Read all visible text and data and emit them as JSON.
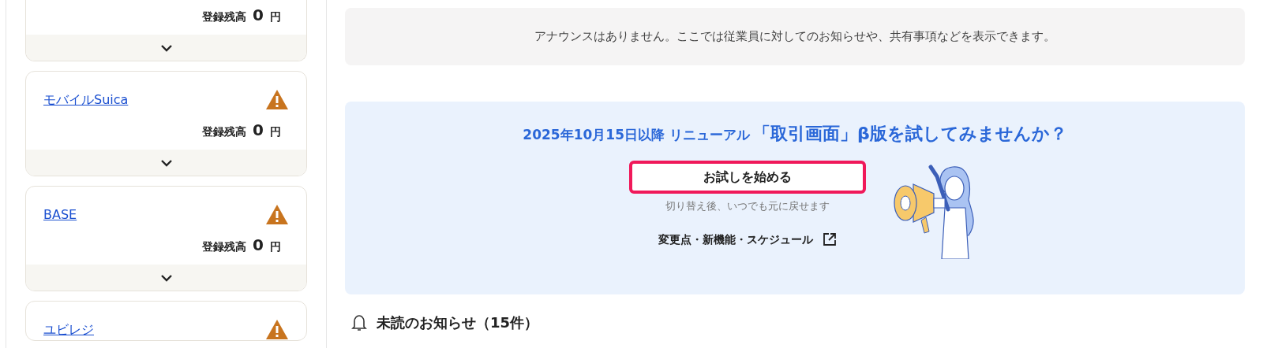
{
  "sidebar": {
    "accounts": [
      {
        "balance_label": "登録残高",
        "amount": "0",
        "unit": "円"
      },
      {
        "name": "モバイルSuica",
        "balance_label": "登録残高",
        "amount": "0",
        "unit": "円"
      },
      {
        "name": "BASE",
        "balance_label": "登録残高",
        "amount": "0",
        "unit": "円"
      },
      {
        "name": "ユビレジ"
      }
    ]
  },
  "announcement": {
    "text": "アナウンスはありません。ここでは従業員に対してのお知らせや、共有事項などを表示できます。"
  },
  "promo": {
    "headline_prefix": "2025年10月15日以降 リニューアル",
    "headline_main": "「取引画面」β版を試してみませんか？",
    "button": "お試しを始める",
    "note": "切り替え後、いつでも元に戻せます",
    "link": "変更点・新機能・スケジュール"
  },
  "notices": {
    "title": "未読のお知らせ（15件）"
  }
}
